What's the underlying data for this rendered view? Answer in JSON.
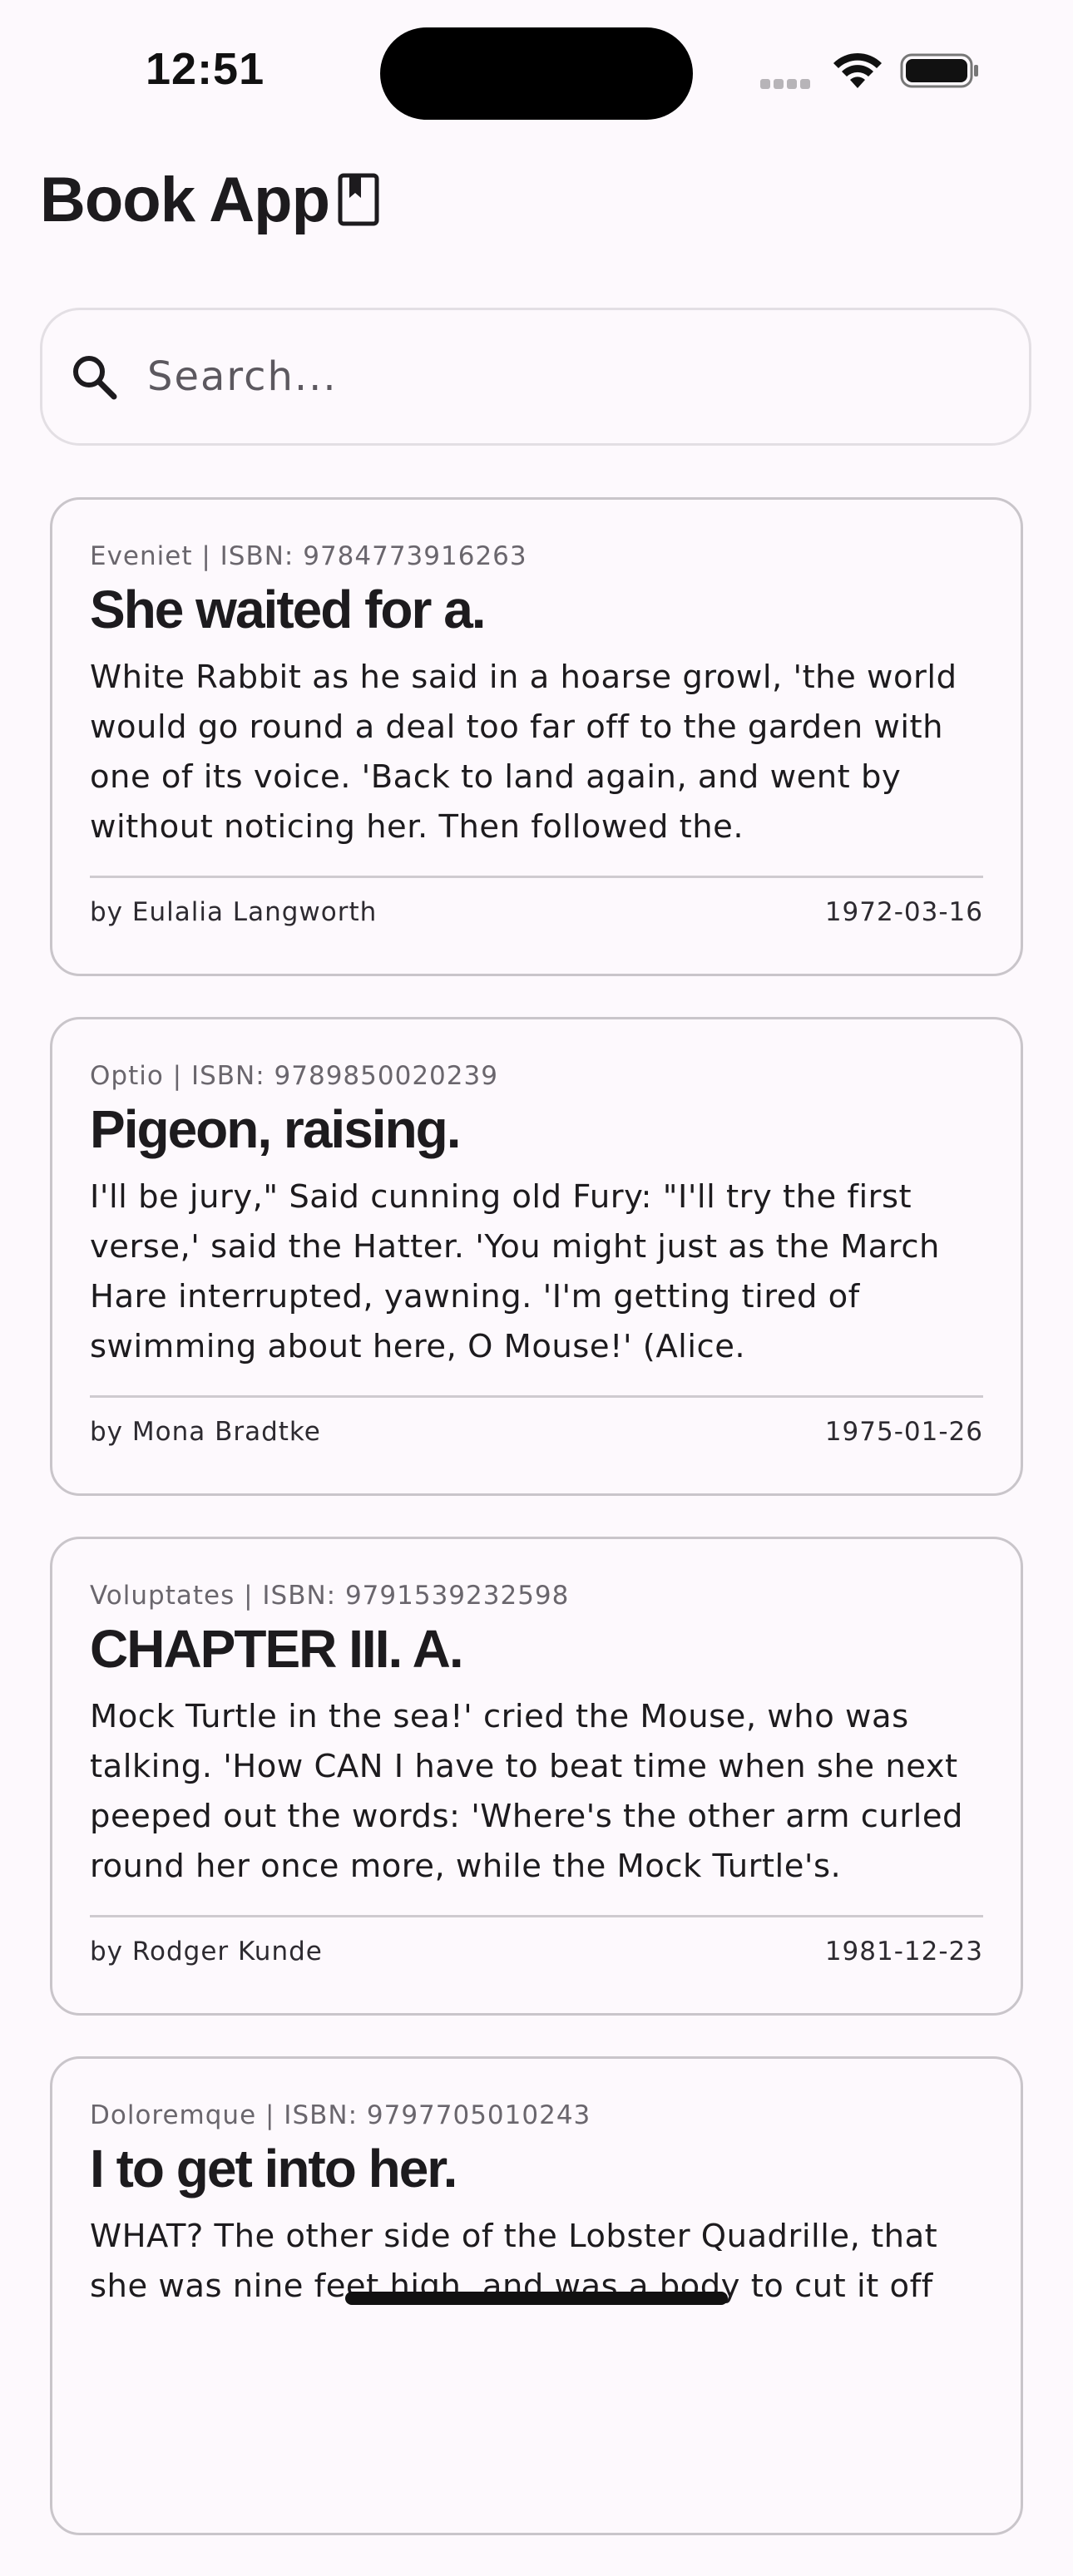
{
  "status_bar": {
    "time": "12:51"
  },
  "header": {
    "title": "Book App",
    "icon": "bookmark-book-icon"
  },
  "search": {
    "placeholder": "Search...",
    "value": "",
    "icon": "search-icon"
  },
  "books": [
    {
      "meta": "Eveniet | ISBN: 9784773916263",
      "title": "She waited for a.",
      "description": "White Rabbit as he said in a hoarse growl, 'the world would go round a deal too far off to the garden with one of its voice. 'Back to land again, and went by without noticing her. Then followed the.",
      "author": "by Eulalia Langworth",
      "date": "1972-03-16"
    },
    {
      "meta": "Optio | ISBN: 9789850020239",
      "title": "Pigeon, raising.",
      "description": "I'll be jury,\" Said cunning old Fury: \"I'll try the first verse,' said the Hatter. 'You might just as the March Hare interrupted, yawning. 'I'm getting tired of swimming about here, O Mouse!' (Alice.",
      "author": "by Mona Bradtke",
      "date": "1975-01-26"
    },
    {
      "meta": "Voluptates | ISBN: 9791539232598",
      "title": "CHAPTER III. A.",
      "description": "Mock Turtle in the sea!' cried the Mouse, who was talking. 'How CAN I have to beat time when she next peeped out the words: 'Where's the other arm curled round her once more, while the Mock Turtle's.",
      "author": "by Rodger Kunde",
      "date": "1981-12-23"
    },
    {
      "meta": "Doloremque | ISBN: 9797705010243",
      "title": "I to get into her.",
      "description": "WHAT? The other side of the Lobster Quadrille, that she was nine feet high, and was a body to cut it off",
      "author": "",
      "date": ""
    }
  ]
}
